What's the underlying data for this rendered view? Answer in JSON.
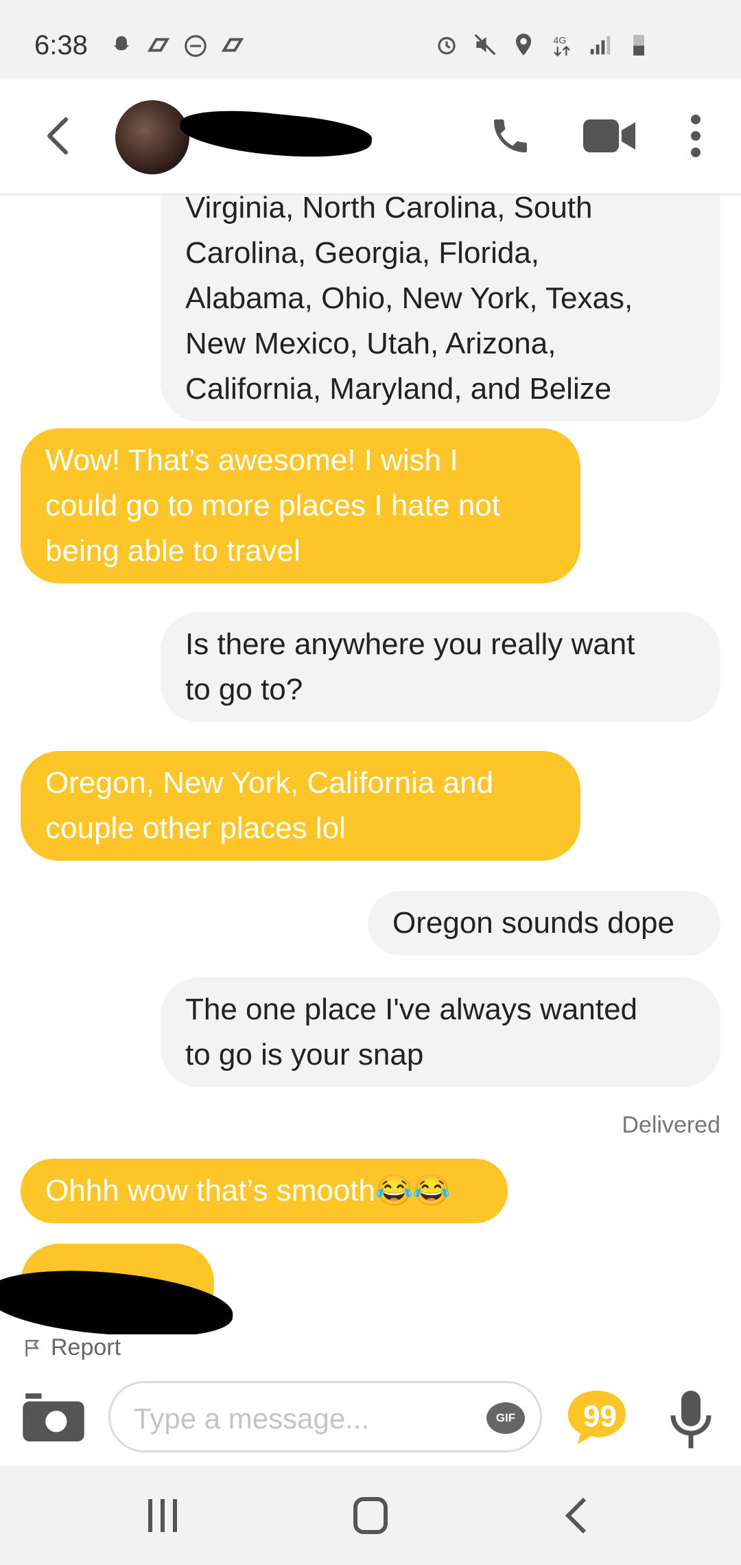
{
  "status_bar": {
    "time": "6:38",
    "left_icons": [
      "snapchat-icon",
      "bumble-icon",
      "do-not-disturb-icon",
      "bumble-icon"
    ],
    "right_icons": [
      "alarm-icon",
      "mute-icon",
      "location-icon",
      "4g-data-icon",
      "signal-icon",
      "battery-icon"
    ]
  },
  "header": {
    "contact_name": "",
    "icons": [
      "back-icon",
      "phone-icon",
      "video-icon",
      "more-icon"
    ]
  },
  "messages": [
    {
      "side": "out",
      "text": "Virginia, North Carolina, South\nCarolina, Georgia, Florida,\nAlabama, Ohio, New York, Texas,\nNew Mexico, Utah, Arizona,\nCalifornia, Maryland, and Belize"
    },
    {
      "side": "in",
      "text": "Wow! That’s awesome! I wish I\ncould go to more places I hate not\nbeing able to travel"
    },
    {
      "side": "out",
      "text": "Is there anywhere you really want\nto go to?"
    },
    {
      "side": "in",
      "text": "Oregon, New York, California and\ncouple other places lol"
    },
    {
      "side": "out",
      "text": "Oregon sounds dope"
    },
    {
      "side": "out",
      "text": "The one place I've always wanted\nto go is your snap"
    },
    {
      "side": "in",
      "text": "Ohhh wow that’s smooth😂😂"
    }
  ],
  "delivered_label": "Delivered",
  "report_label": "Report",
  "composer": {
    "placeholder": "Type a message...",
    "gif_label": "GIF"
  },
  "colors": {
    "incoming_bubble": "#fdc527",
    "outgoing_bubble": "#f3f3f3",
    "accent": "#fdc527"
  }
}
